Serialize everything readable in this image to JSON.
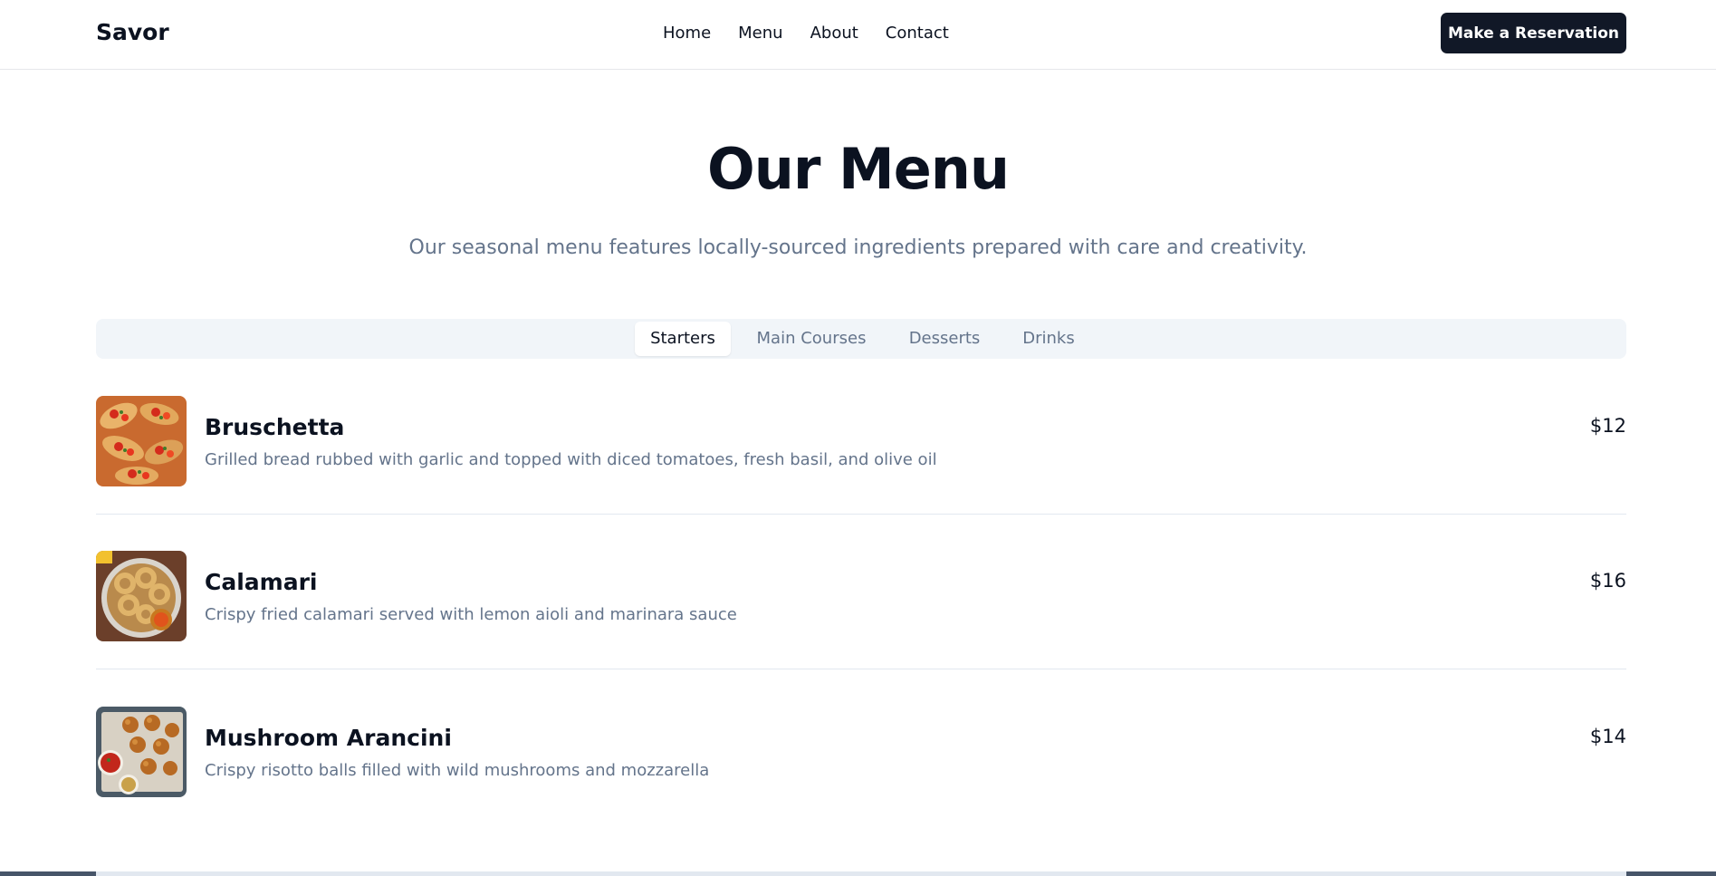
{
  "header": {
    "brand": "Savor",
    "nav": [
      "Home",
      "Menu",
      "About",
      "Contact"
    ],
    "cta": "Make a Reservation"
  },
  "hero": {
    "title": "Our Menu",
    "subtitle": "Our seasonal menu features locally-sourced ingredients prepared with care and creativity."
  },
  "tabs": [
    {
      "label": "Starters",
      "active": true
    },
    {
      "label": "Main Courses",
      "active": false
    },
    {
      "label": "Desserts",
      "active": false
    },
    {
      "label": "Drinks",
      "active": false
    }
  ],
  "items": [
    {
      "name": "Bruschetta",
      "description": "Grilled bread rubbed with garlic and topped with diced tomatoes, fresh basil, and olive oil",
      "price": "$12",
      "image": "bruschetta-photo"
    },
    {
      "name": "Calamari",
      "description": "Crispy fried calamari served with lemon aioli and marinara sauce",
      "price": "$16",
      "image": "calamari-photo"
    },
    {
      "name": "Mushroom Arancini",
      "description": "Crispy risotto balls filled with wild mushrooms and mozzarella",
      "price": "$14",
      "image": "arancini-photo"
    }
  ],
  "colors": {
    "primary": "#111827",
    "muted_text": "#64748b",
    "tab_bg": "#f1f5f9",
    "divider": "#e2e8f0"
  }
}
